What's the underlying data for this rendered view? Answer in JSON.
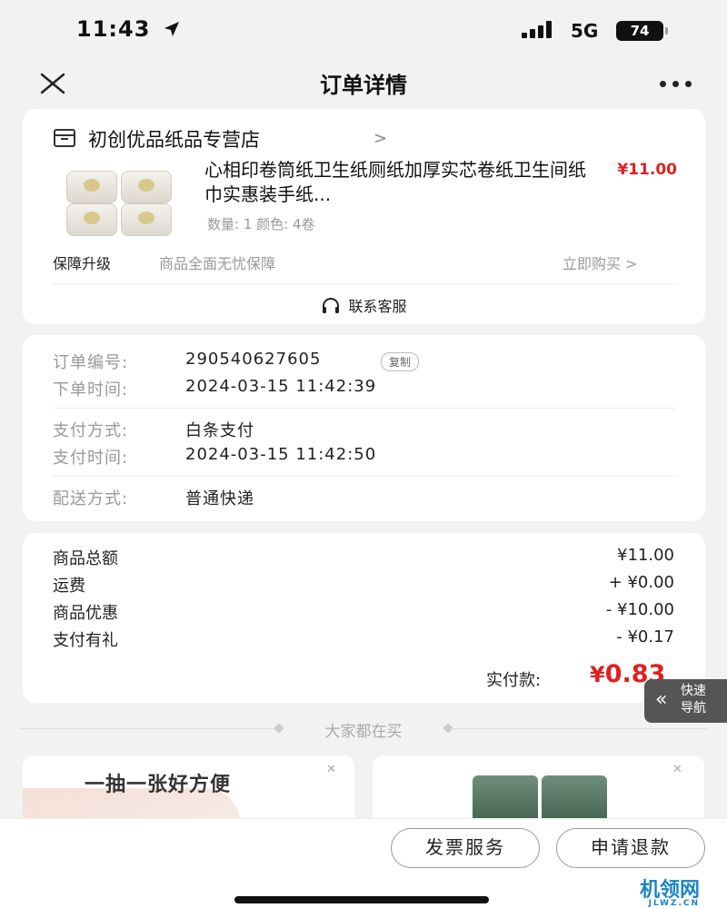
{
  "status_bar": {
    "time": "11:43",
    "network": "5G",
    "battery": "74"
  },
  "nav": {
    "title": "订单详情"
  },
  "shop": {
    "name": "初创优品纸品专营店",
    "product_title": "心相印卷筒纸卫生纸厕纸加厚实芯卷纸卫生间纸巾实惠装手纸...",
    "price": "¥11.00",
    "meta": "数量: 1 颜色: 4卷",
    "guarantee_label": "保障升级",
    "guarantee_text": "商品全面无忧保障",
    "buy_now": "立即购买 >",
    "support": "联系客服"
  },
  "order_info": {
    "order_no_label": "订单编号:",
    "order_no": "290540627605",
    "copy": "复制",
    "order_time_label": "下单时间:",
    "order_time": "2024-03-15 11:42:39",
    "pay_method_label": "支付方式:",
    "pay_method": "白条支付",
    "pay_time_label": "支付时间:",
    "pay_time": "2024-03-15 11:42:50",
    "delivery_label": "配送方式:",
    "delivery": "普通快递"
  },
  "amounts": {
    "subtotal_label": "商品总额",
    "subtotal": "¥11.00",
    "shipping_label": "运费",
    "shipping": "+ ¥0.00",
    "discount_label": "商品优惠",
    "discount": "- ¥10.00",
    "pay_gift_label": "支付有礼",
    "pay_gift": "- ¥0.17",
    "paid_label": "实付款:",
    "paid_symbol": "¥",
    "paid": "0.83"
  },
  "quick_nav": {
    "label_1": "快速",
    "label_2": "导航"
  },
  "recommend": {
    "title": "大家都在买",
    "card1_text": "一抽一张好方便"
  },
  "actions": {
    "invoice": "发票服务",
    "refund": "申请退款"
  },
  "watermark": {
    "main": "机领网",
    "sub": "JLWZ.CN"
  },
  "colors": {
    "price_red": "#e02020",
    "background": "#f2f2f2"
  }
}
